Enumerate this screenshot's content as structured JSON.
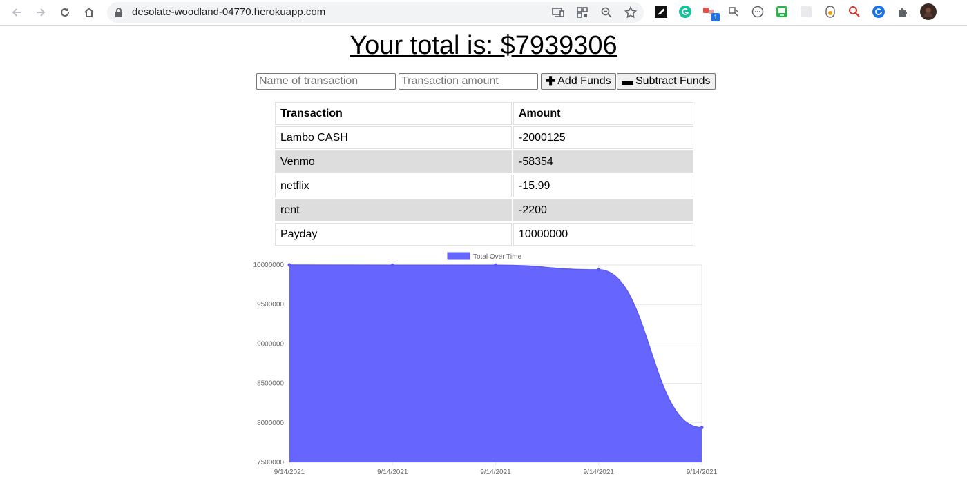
{
  "browser": {
    "url": "desolate-woodland-04770.herokuapp.com",
    "extension_badge": "1"
  },
  "page": {
    "total_label": "Your total is: $7939306"
  },
  "form": {
    "name_placeholder": "Name of transaction",
    "amount_placeholder": "Transaction amount",
    "add_label": "Add Funds",
    "subtract_label": "Subtract Funds"
  },
  "table": {
    "headers": [
      "Transaction",
      "Amount"
    ],
    "rows": [
      {
        "name": "Lambo CASH",
        "amount": "-2000125"
      },
      {
        "name": "Venmo",
        "amount": "-58354"
      },
      {
        "name": "netflix",
        "amount": "-15.99"
      },
      {
        "name": "rent",
        "amount": "-2200"
      },
      {
        "name": "Payday",
        "amount": "10000000"
      }
    ]
  },
  "chart_data": {
    "type": "area",
    "x": [
      "9/14/2021",
      "9/14/2021",
      "9/14/2021",
      "9/14/2021",
      "9/14/2021"
    ],
    "series": [
      {
        "name": "Total Over Time",
        "values": [
          10000000,
          9997800,
          9997784.01,
          9939430.01,
          7939305.01
        ],
        "color": "#6666ff"
      }
    ],
    "yticks": [
      "10000000",
      "9500000",
      "9000000",
      "8500000",
      "8000000",
      "7500000"
    ],
    "ylim": [
      7500000,
      10000000
    ],
    "legend": "top-center",
    "grid": true
  }
}
